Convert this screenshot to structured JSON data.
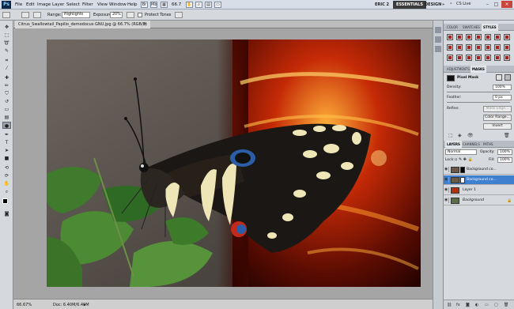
{
  "menubar": {
    "logo": "Ps",
    "items": [
      "File",
      "Edit",
      "Image",
      "Layer",
      "Select",
      "Filter",
      "View",
      "Window",
      "Help"
    ],
    "zoom": "66.7",
    "workspaces": [
      "ERIC 2",
      "ESSENTIALS",
      "DESIGN",
      "»"
    ],
    "cs_live": "CS Live"
  },
  "options": {
    "range_label": "Range:",
    "range_value": "Highlights",
    "exposure_label": "Exposure:",
    "exposure_value": "20%",
    "protect_tones_label": "Protect Tones"
  },
  "document": {
    "title": "Citrus_Swallowtail_Papilio_demodocus GNU.jpg @ 66.7% (RGB/8)",
    "close": "×"
  },
  "status": {
    "zoom": "66.67%",
    "doc": "Doc: 6.40M/6.40M"
  },
  "panels": {
    "top_tabs": [
      "COLOR",
      "SWATCHES",
      "STYLES"
    ],
    "mid_tabs": [
      "ADJUSTMENTS",
      "MASKS"
    ],
    "masks": {
      "pixel_mask_label": "Pixel Mask",
      "density_label": "Density:",
      "density_value": "100%",
      "feather_label": "Feather:",
      "feather_value": "0 px",
      "refine_label": "Refine:",
      "mask_edge": "Mask Edge...",
      "color_range": "Color Range...",
      "invert": "Invert"
    },
    "layer_tabs": [
      "LAYERS",
      "CHANNELS",
      "PATHS"
    ],
    "blend_mode": "Normal",
    "opacity_label": "Opacity:",
    "opacity_value": "100%",
    "lock_label": "Lock:",
    "fill_label": "Fill:",
    "fill_value": "100%",
    "layers": [
      {
        "name": "Background co..."
      },
      {
        "name": "Background co..."
      },
      {
        "name": "Layer 1"
      },
      {
        "name": "Background"
      }
    ]
  }
}
